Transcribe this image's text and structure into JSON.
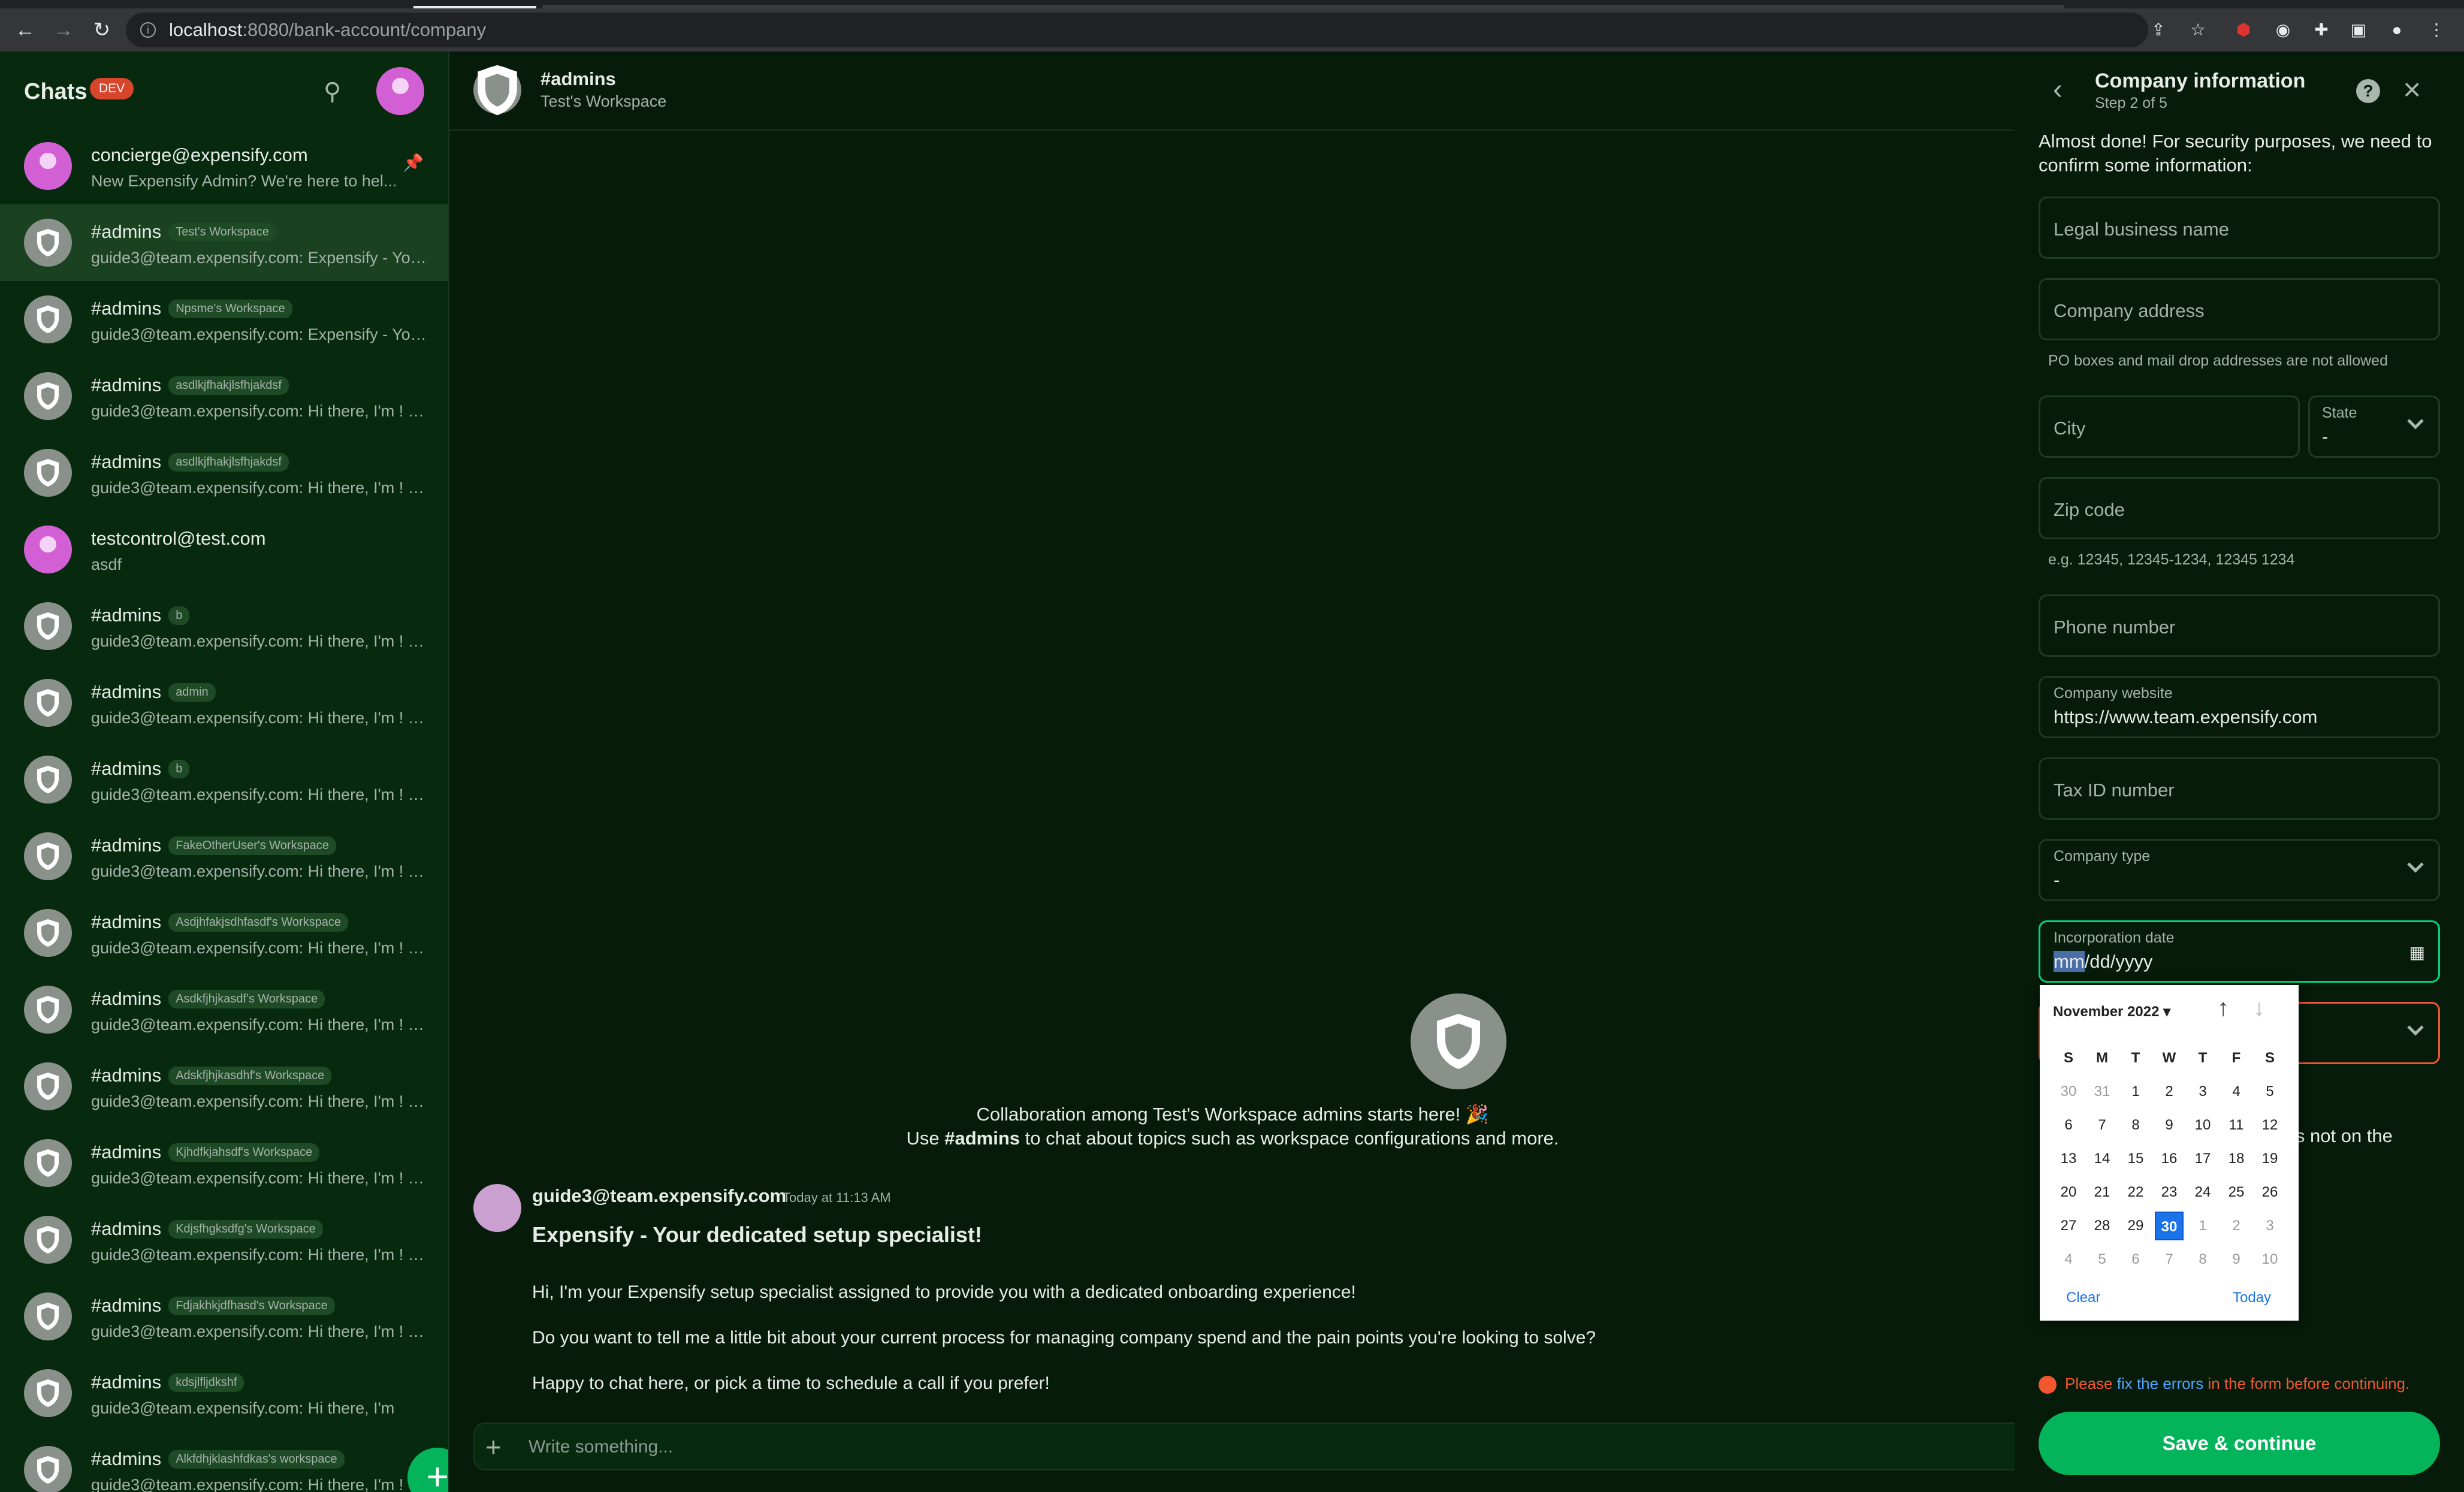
{
  "browser": {
    "url_host": "localhost",
    "url_path": ":8080/bank-account/company"
  },
  "sidebar": {
    "title": "Chats",
    "badge": "DEV",
    "items": [
      {
        "name": "concierge@expensify.com",
        "tag": "",
        "preview": "New Expensify Admin? We're here to hel...",
        "avatar": "user",
        "pinned": true,
        "active": false
      },
      {
        "name": "#admins",
        "tag": "Test's Workspace",
        "preview": "guide3@team.expensify.com: Expensify - You...",
        "avatar": "shield",
        "active": true
      },
      {
        "name": "#admins",
        "tag": "Npsme's Workspace",
        "preview": "guide3@team.expensify.com: Expensify - You...",
        "avatar": "shield"
      },
      {
        "name": "#admins",
        "tag": "asdlkjfhakjlsfhjakdsf",
        "preview": "guide3@team.expensify.com: Hi there, I'm ! I'...",
        "avatar": "shield"
      },
      {
        "name": "#admins",
        "tag": "asdlkjfhakjlsfhjakdsf",
        "preview": "guide3@team.expensify.com: Hi there, I'm ! I'...",
        "avatar": "shield"
      },
      {
        "name": "testcontrol@test.com",
        "tag": "",
        "preview": "asdf",
        "avatar": "user"
      },
      {
        "name": "#admins",
        "tag": "b",
        "preview": "guide3@team.expensify.com: Hi there, I'm ! I'...",
        "avatar": "shield"
      },
      {
        "name": "#admins",
        "tag": "admin",
        "preview": "guide3@team.expensify.com: Hi there, I'm ! I'...",
        "avatar": "shield"
      },
      {
        "name": "#admins",
        "tag": "b",
        "preview": "guide3@team.expensify.com: Hi there, I'm ! I'...",
        "avatar": "shield"
      },
      {
        "name": "#admins",
        "tag": "FakeOtherUser's Workspace",
        "preview": "guide3@team.expensify.com: Hi there, I'm ! I'...",
        "avatar": "shield"
      },
      {
        "name": "#admins",
        "tag": "Asdjhfakjsdhfasdf's Workspace",
        "preview": "guide3@team.expensify.com: Hi there, I'm ! I'...",
        "avatar": "shield"
      },
      {
        "name": "#admins",
        "tag": "Asdkfjhjkasdf's Workspace",
        "preview": "guide3@team.expensify.com: Hi there, I'm ! I'...",
        "avatar": "shield"
      },
      {
        "name": "#admins",
        "tag": "Adskfjhjkasdhf's Workspace",
        "preview": "guide3@team.expensify.com: Hi there, I'm ! I'...",
        "avatar": "shield"
      },
      {
        "name": "#admins",
        "tag": "Kjhdfkjahsdf's Workspace",
        "preview": "guide3@team.expensify.com: Hi there, I'm ! I'...",
        "avatar": "shield"
      },
      {
        "name": "#admins",
        "tag": "Kdjsfhgksdfg's Workspace",
        "preview": "guide3@team.expensify.com: Hi there, I'm ! I'...",
        "avatar": "shield"
      },
      {
        "name": "#admins",
        "tag": "Fdjakhkjdfhasd's Workspace",
        "preview": "guide3@team.expensify.com: Hi there, I'm ! I'...",
        "avatar": "shield"
      },
      {
        "name": "#admins",
        "tag": "kdsjlfljdkshf",
        "preview": "guide3@team.expensify.com: Hi there, I'm",
        "avatar": "shield"
      },
      {
        "name": "#admins",
        "tag": "Alkfdhjklashfdkas's workspace",
        "preview": "guide3@team.expensify.com: Hi there, I'm ! I'...",
        "avatar": "shield"
      }
    ]
  },
  "chat": {
    "title": "#admins",
    "subtitle": "Test's Workspace",
    "welcome_line1": "Collaboration among Test's Workspace admins starts here! 🎉",
    "welcome_line2_pre": "Use ",
    "welcome_line2_bold": "#admins",
    "welcome_line2_post": " to chat about topics such as workspace configurations and more.",
    "message": {
      "from": "guide3@team.expensify.com",
      "time": "Today at 11:13 AM",
      "title": "Expensify - Your dedicated setup specialist!",
      "p1": "Hi, I'm your Expensify setup specialist assigned to provide you with a dedicated onboarding experience!",
      "p2": "Do you want to tell me a little bit about your current process for managing company spend and the pain points you're looking to solve?",
      "p3": "Happy to chat here, or pick a time to schedule a call if you prefer!"
    },
    "composer_placeholder": "Write something..."
  },
  "panel": {
    "title": "Company information",
    "step": "Step 2 of 5",
    "intro": "Almost done! For security purposes, we need to confirm some information:",
    "legal_name": "Legal business name",
    "address": "Company address",
    "address_hint": "PO boxes and mail drop addresses are not allowed",
    "city": "City",
    "state_label": "State",
    "state_value": "-",
    "zip": "Zip code",
    "zip_hint": "e.g. 12345, 12345-1234, 12345 1234",
    "phone": "Phone number",
    "website_label": "Company website",
    "website_value": "https://www.team.expensify.com",
    "tax_id": "Tax ID number",
    "company_type_label": "Company type",
    "company_type_value": "-",
    "inc_date_label": "Incorporation date",
    "inc_date_mm": "mm",
    "inc_date_rest": "/dd/yyyy",
    "partial_text_a": "is not on the",
    "partial_text_b": ".",
    "error_pre": "Please ",
    "error_link": "fix the errors",
    "error_post": " in the form before continuing.",
    "save_label": "Save & continue"
  },
  "datepicker": {
    "month": "November 2022",
    "weekdays": [
      "S",
      "M",
      "T",
      "W",
      "T",
      "F",
      "S"
    ],
    "weeks": [
      [
        "30",
        "31",
        "1",
        "2",
        "3",
        "4",
        "5"
      ],
      [
        "6",
        "7",
        "8",
        "9",
        "10",
        "11",
        "12"
      ],
      [
        "13",
        "14",
        "15",
        "16",
        "17",
        "18",
        "19"
      ],
      [
        "20",
        "21",
        "22",
        "23",
        "24",
        "25",
        "26"
      ],
      [
        "27",
        "28",
        "29",
        "30",
        "1",
        "2",
        "3"
      ],
      [
        "4",
        "5",
        "6",
        "7",
        "8",
        "9",
        "10"
      ]
    ],
    "selected_day": "30",
    "clear": "Clear",
    "today": "Today"
  },
  "colors": {
    "app_bg": "#061b09",
    "sidebar_bg": "#072a0f",
    "accent_green": "#03b45a",
    "danger": "#f25730",
    "picker_select": "#1a73e8"
  }
}
